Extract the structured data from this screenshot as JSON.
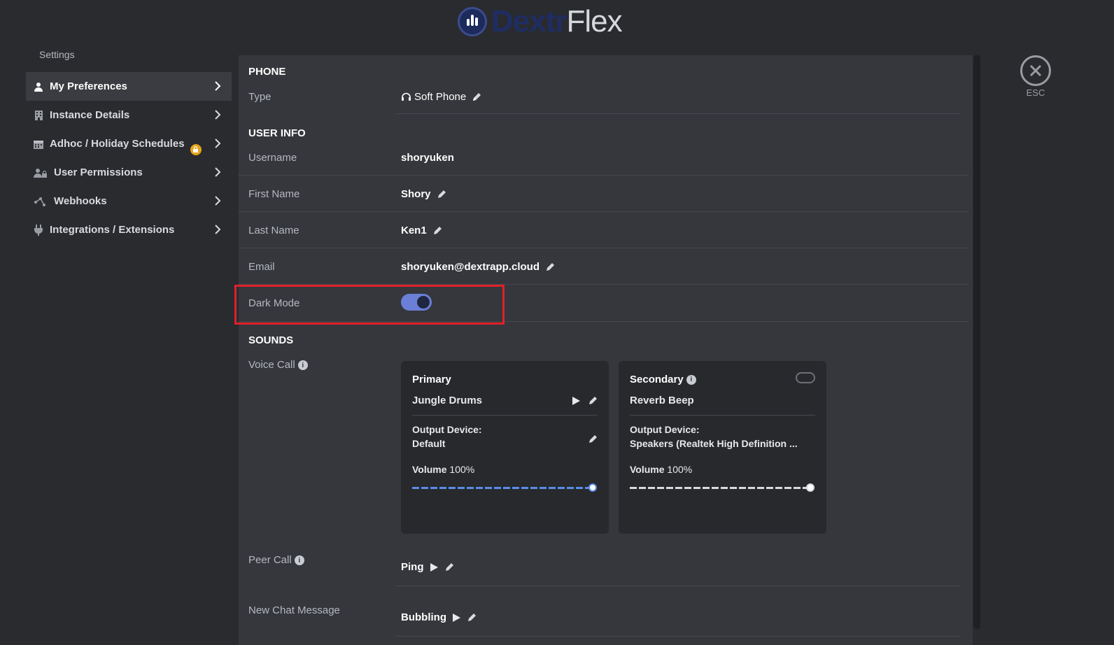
{
  "brand": {
    "part1": "Dextr",
    "part2": "Flex"
  },
  "settings_label": "Settings",
  "sidebar": {
    "items": [
      {
        "label": "My Preferences",
        "icon": "user-icon",
        "active": true
      },
      {
        "label": "Instance Details",
        "icon": "building-icon"
      },
      {
        "label": "Adhoc / Holiday Schedules",
        "icon": "calendar-icon",
        "badge": "lock-icon"
      },
      {
        "label": "User Permissions",
        "icon": "user-lock-icon"
      },
      {
        "label": "Webhooks",
        "icon": "webhook-icon"
      },
      {
        "label": "Integrations / Extensions",
        "icon": "plug-icon"
      }
    ]
  },
  "phone": {
    "title": "PHONE",
    "type_label": "Type",
    "type_value": "Soft Phone"
  },
  "user_info": {
    "title": "USER INFO",
    "username_label": "Username",
    "username_value": "shoryuken",
    "first_name_label": "First Name",
    "first_name_value": "Shory",
    "last_name_label": "Last Name",
    "last_name_value": "Ken1",
    "email_label": "Email",
    "email_value": "shoryuken@dextrapp.cloud",
    "dark_mode_label": "Dark Mode",
    "dark_mode_on": true
  },
  "sounds": {
    "title": "SOUNDS",
    "voice_call_label": "Voice Call",
    "primary": {
      "title": "Primary",
      "sound": "Jungle Drums",
      "output_label": "Output Device:",
      "output_value": "Default",
      "volume_label": "Volume",
      "volume_value": "100%",
      "volume": 1.0
    },
    "secondary": {
      "title": "Secondary",
      "sound": "Reverb Beep",
      "output_label": "Output Device:",
      "output_value": "Speakers (Realtek High Definition ...",
      "volume_label": "Volume",
      "volume_value": "100%",
      "volume": 1.0,
      "enabled": false
    },
    "peer_call_label": "Peer Call",
    "peer_call_value": "Ping",
    "new_chat_label": "New Chat Message",
    "new_chat_value": "Bubbling"
  },
  "esc_label": "ESC",
  "colors": {
    "accent": "#6b7fd6",
    "slider": "#5b8de8",
    "badge": "#e8a317",
    "highlight": "#e0202a"
  }
}
